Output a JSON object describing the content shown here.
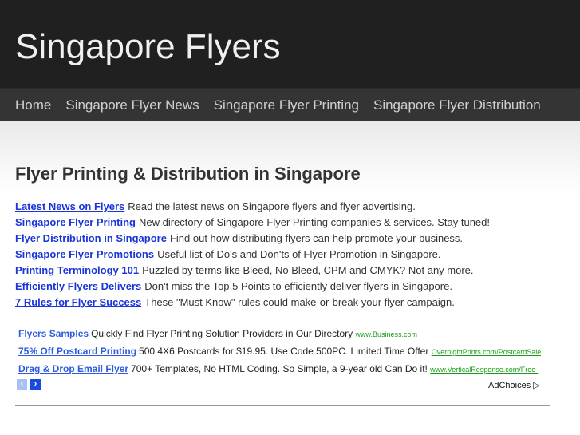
{
  "header": {
    "title": "Singapore Flyers"
  },
  "nav": [
    "Home",
    "Singapore Flyer News",
    "Singapore Flyer Printing",
    "Singapore Flyer Distribution"
  ],
  "main": {
    "heading": "Flyer Printing & Distribution in Singapore",
    "items": [
      {
        "link": "Latest News on Flyers",
        "text": "Read the latest news on Singapore flyers and flyer advertising."
      },
      {
        "link": "Singapore Flyer Printing",
        "text": "New directory of Singapore Flyer Printing companies & services. Stay tuned!"
      },
      {
        "link": "Flyer Distribution in Singapore",
        "text": "Find out how distributing flyers can help promote your business."
      },
      {
        "link": "Singapore Flyer Promotions",
        "text": "Useful list of Do's and Don'ts of Flyer Promotion in Singapore."
      },
      {
        "link": "Printing Terminology 101",
        "text": "Puzzled by terms like Bleed, No Bleed, CPM and CMYK? Not any more."
      },
      {
        "link": "Efficiently Flyers Delivers",
        "text": "Don't miss the Top 5 Points to efficiently deliver flyers in Singapore."
      },
      {
        "link": "7 Rules for Flyer Success",
        "text": "These \"Must Know\" rules could make-or-break your flyer campaign."
      }
    ]
  },
  "ads": {
    "items": [
      {
        "title": "Flyers Samples",
        "text": "Quickly Find Flyer Printing Solution Providers in Our Directory",
        "url": "www.Business.com"
      },
      {
        "title": "75% Off Postcard Printing",
        "text": "500 4X6 Postcards for $19.95. Use Code 500PC. Limited Time Offer",
        "url": "OvernightPrints.com/PostcardSale"
      },
      {
        "title": "Drag & Drop Email Flyer",
        "text": "700+ Templates, No HTML Coding. So Simple, a 9-year old Can Do it!",
        "url": "www.VerticalResponse.com/Free-"
      }
    ],
    "prev": "‹",
    "next": "›",
    "adchoices": "AdChoices ▷"
  }
}
